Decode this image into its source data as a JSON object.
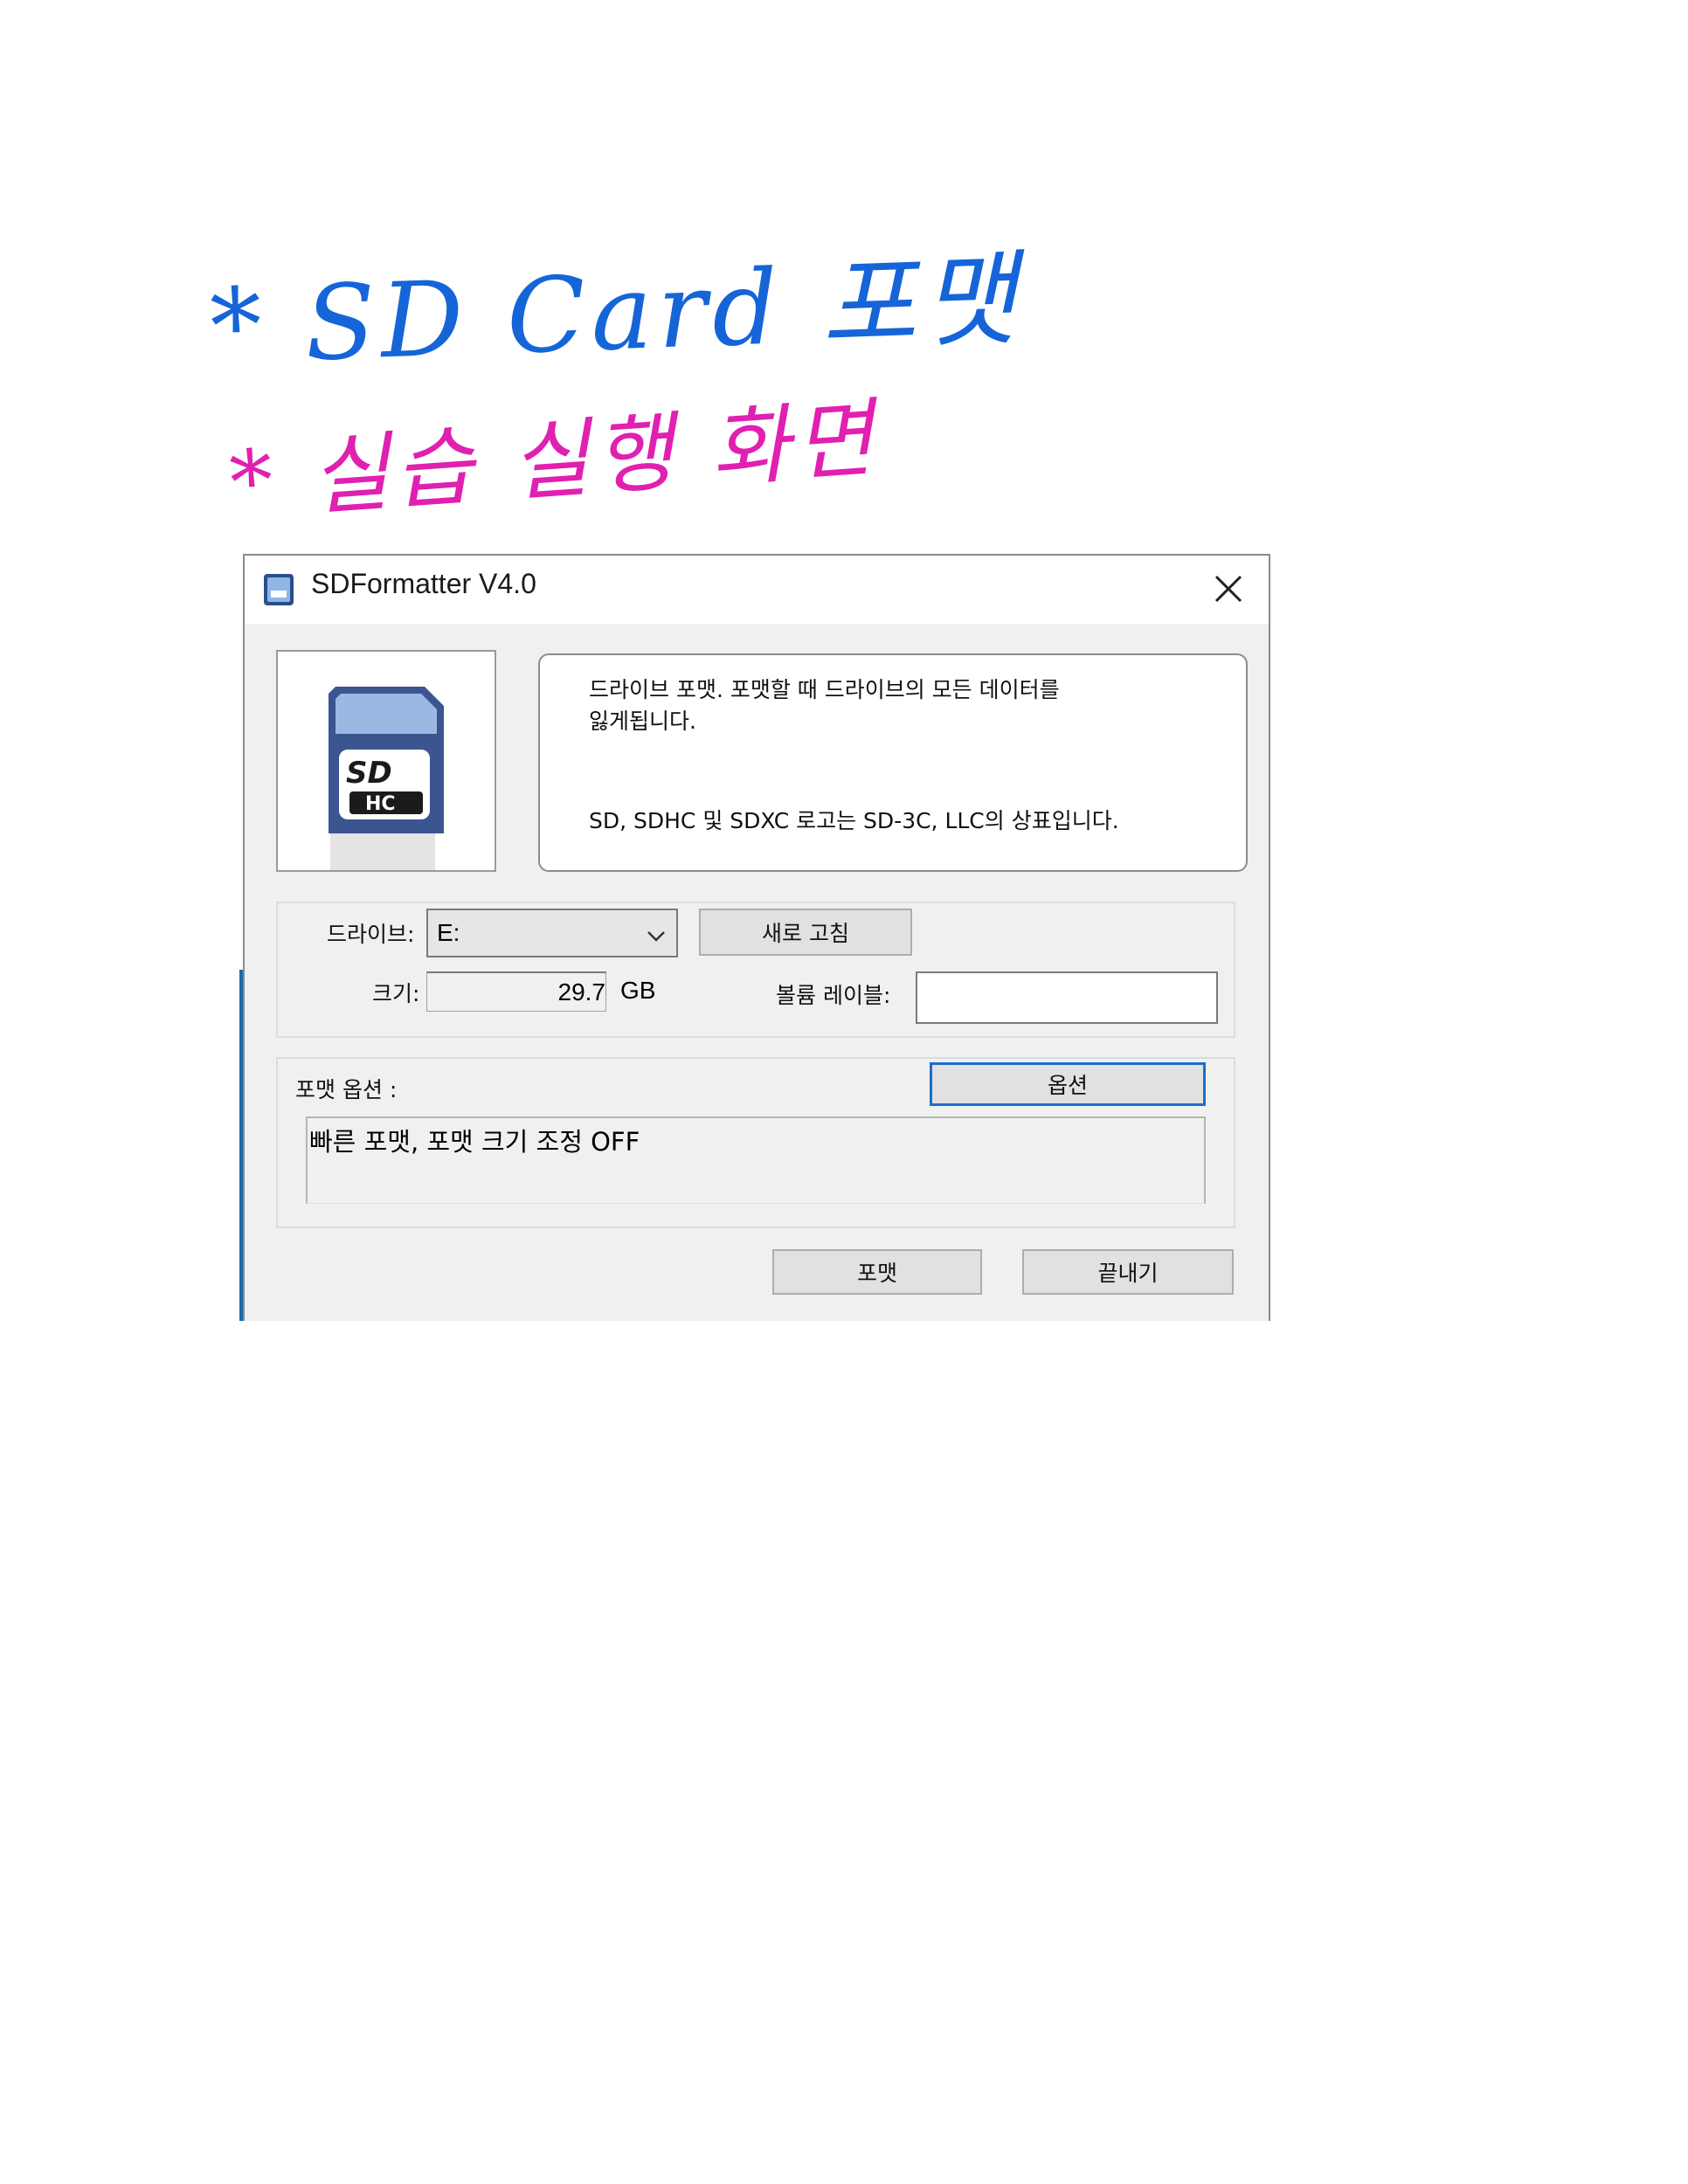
{
  "notes": {
    "line1": "* SD Card 포맷",
    "line2": "* 실습 실행 화면"
  },
  "window": {
    "title": "SDFormatter V4.0",
    "app_icon": "sd-card-app-icon",
    "close_icon": "close-icon"
  },
  "info": {
    "message": "드라이브 포맷. 포맷할 때 드라이브의 모든 데이터를 잃게됩니다.",
    "trademark": "SD, SDHC 및 SDXC 로고는 SD-3C, LLC의 상표입니다."
  },
  "drive": {
    "label": "드라이브:",
    "value": "E:",
    "refresh_label": "새로 고침"
  },
  "size": {
    "label": "크기:",
    "value": "29.7",
    "unit": "GB"
  },
  "volume": {
    "label": "볼륨 레이블:",
    "value": ""
  },
  "format_options": {
    "label": "포맷 옵션 :",
    "option_button": "옵션",
    "current": "빠른 포맷, 포맷 크기 조정 OFF"
  },
  "actions": {
    "format_label": "포맷",
    "exit_label": "끝내기"
  },
  "colors": {
    "note_blue": "#1565d8",
    "note_pink": "#e020b0",
    "focus_border": "#1b6dcc"
  }
}
